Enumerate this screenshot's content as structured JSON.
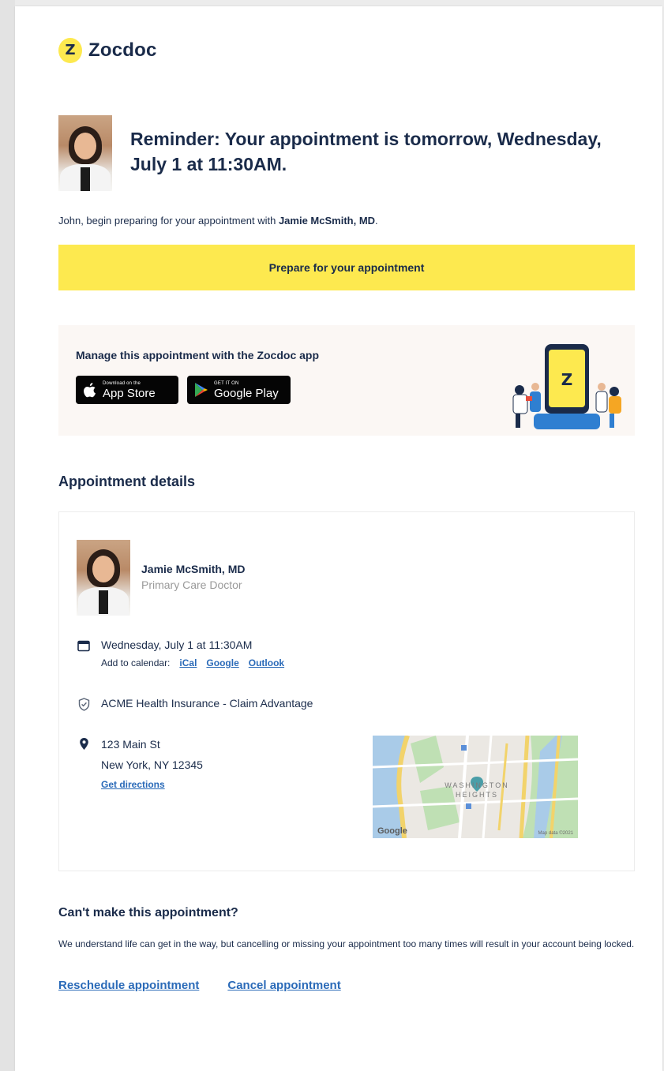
{
  "brand": {
    "logo_glyph": "Z",
    "name": "Zocdoc",
    "accent_color": "#fde94f",
    "text_color": "#1a2b4a",
    "link_color": "#2a6ab8"
  },
  "hero": {
    "headline": "Reminder: Your appointment is tomorrow, Wednesday, July 1 at 11:30AM.",
    "intro_prefix": "John, begin preparing for your appointment with ",
    "intro_doctor": "Jamie McSmith, MD",
    "intro_suffix": "."
  },
  "prepare_button": {
    "label": "Prepare for your appointment"
  },
  "app_promo": {
    "title": "Manage this appointment with the Zocdoc app",
    "appstore_small": "Download on the",
    "appstore_big": "App Store",
    "gplay_small": "GET IT ON",
    "gplay_big": "Google Play",
    "illustration_glyph": "Z"
  },
  "details": {
    "section_title": "Appointment details",
    "doctor_name": "Jamie McSmith, MD",
    "doctor_specialty": "Primary Care Doctor",
    "datetime": "Wednesday, July 1 at 11:30AM",
    "add_to_calendar_label": "Add to calendar:",
    "calendar_links": [
      "iCal",
      "Google",
      "Outlook"
    ],
    "insurance": "ACME Health Insurance - Claim Advantage",
    "address_line1": "123 Main St",
    "address_line2": "New York, NY 12345",
    "directions_label": "Get directions",
    "map": {
      "neighborhood_line1": "WASHINGTON",
      "neighborhood_line2": "HEIGHTS",
      "attribution": "Google",
      "map_data": "Map data ©2021"
    }
  },
  "cancel_section": {
    "title": "Can't make this appointment?",
    "body": "We understand life can get in the way, but cancelling or missing your appointment too many times will result in your account being locked.",
    "reschedule_label": "Reschedule appointment",
    "cancel_label": "Cancel appointment"
  }
}
